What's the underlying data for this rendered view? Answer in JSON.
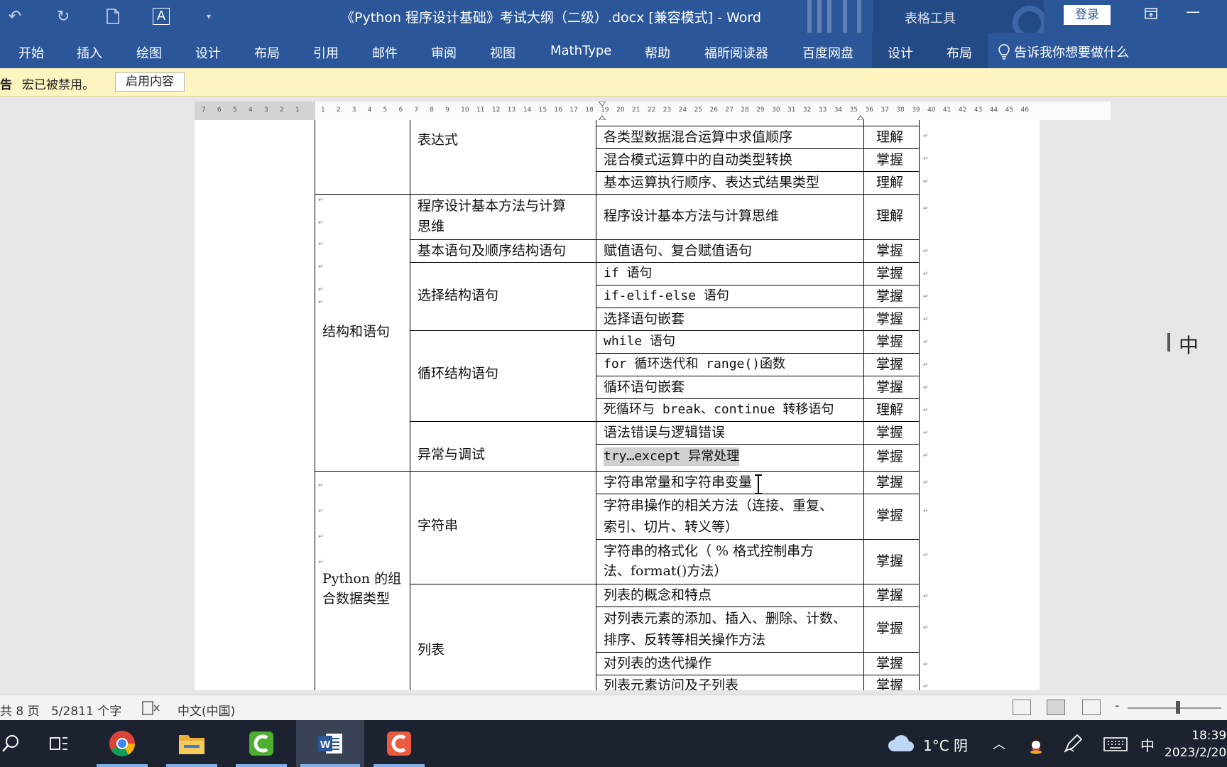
{
  "window": {
    "title": "《Python 程序设计基础》考试大纲（二级）.docx [兼容模式]  -  Word",
    "context_group": "表格工具",
    "login_label": "登录"
  },
  "ribbon": {
    "tabs": [
      "开始",
      "插入",
      "绘图",
      "设计",
      "布局",
      "引用",
      "邮件",
      "审阅",
      "视图",
      "MathType",
      "帮助",
      "福昕阅读器",
      "百度网盘",
      "设计",
      "布局"
    ],
    "tell_me": "告诉我你想要做什么"
  },
  "message_bar": {
    "warning": "告",
    "message": "宏已被禁用。",
    "button": "启用内容"
  },
  "ruler": {
    "left_ticks": [
      "7",
      "6",
      "5",
      "4",
      "3",
      "2",
      "1"
    ],
    "right_ticks": [
      "1",
      "2",
      "3",
      "4",
      "5",
      "6",
      "7",
      "8",
      "9",
      "10",
      "11",
      "12",
      "13",
      "14",
      "15",
      "16",
      "17",
      "18",
      "19",
      "20",
      "21",
      "22",
      "23",
      "24",
      "25",
      "26",
      "27",
      "28",
      "29",
      "30",
      "31",
      "32",
      "33",
      "34",
      "35",
      "36",
      "37",
      "38",
      "39",
      "40",
      "41",
      "42",
      "43",
      "44",
      "45",
      "46"
    ]
  },
  "table": {
    "groups": [
      "结构和语句",
      "Python 的组合数据类型"
    ],
    "categories": [
      "表达式",
      "程序设计基本方法与计算思维",
      "基本语句及顺序结构语句",
      "选择结构语句",
      "循环结构语句",
      "异常与调试",
      "字符串",
      "列表"
    ],
    "items": [
      {
        "text": "各类型数据混合运算中求值顺序",
        "level": "理解"
      },
      {
        "text": "混合模式运算中的自动类型转换",
        "level": "掌握"
      },
      {
        "text": "基本运算执行顺序、表达式结果类型",
        "level": "理解"
      },
      {
        "text": "程序设计基本方法与计算思维",
        "level": "理解"
      },
      {
        "text": "赋值语句、复合赋值语句",
        "level": "掌握"
      },
      {
        "text": "if 语句",
        "level": "掌握"
      },
      {
        "text": "if-elif-else 语句",
        "level": "掌握"
      },
      {
        "text": "选择语句嵌套",
        "level": "掌握"
      },
      {
        "text": "while 语句",
        "level": "掌握"
      },
      {
        "text": "for 循环迭代和 range()函数",
        "level": "掌握"
      },
      {
        "text": "循环语句嵌套",
        "level": "掌握"
      },
      {
        "text": "死循环与 break、continue 转移语句",
        "level": "理解"
      },
      {
        "text": "语法错误与逻辑错误",
        "level": "掌握"
      },
      {
        "text": "try…except 异常处理",
        "level": "掌握"
      },
      {
        "text": "字符串常量和字符串变量",
        "level": "掌握"
      },
      {
        "text": "字符串操作的相关方法（连接、重复、索引、切片、转义等）",
        "level": "掌握"
      },
      {
        "text": "字符串的格式化（ % 格式控制串方法、format()方法）",
        "level": "掌握"
      },
      {
        "text": "列表的概念和特点",
        "level": "掌握"
      },
      {
        "text": "对列表元素的添加、插入、删除、计数、排序、反转等相关操作方法",
        "level": "掌握"
      },
      {
        "text": "对列表的迭代操作",
        "level": "掌握"
      },
      {
        "text": "列表元素访问及子列表",
        "level": "掌握"
      }
    ],
    "split_lines": {
      "cat_prog_l1": "程序设计基本方法与计算",
      "cat_prog_l2": "思维",
      "grp2_l1": "Python 的组",
      "grp2_l2": "合数据类型",
      "item15_l1": "字符串操作的相关方法（连接、重复、",
      "item15_l2": "索引、切片、转义等）",
      "item16_l1": "字符串的格式化（ % 格式控制串方",
      "item16_l2": "法、format()方法）",
      "item18_l1": "对列表元素的添加、插入、删除、计数、",
      "item18_l2": "排序、反转等相关操作方法"
    }
  },
  "ime_float": "中",
  "status": {
    "pages": "共 8 页",
    "words": "5/2811 个字",
    "language": "中文(中国)"
  },
  "taskbar": {
    "weather": "1°C 阴",
    "ime": "中",
    "time": "18:39",
    "date": "2023/2/20"
  }
}
